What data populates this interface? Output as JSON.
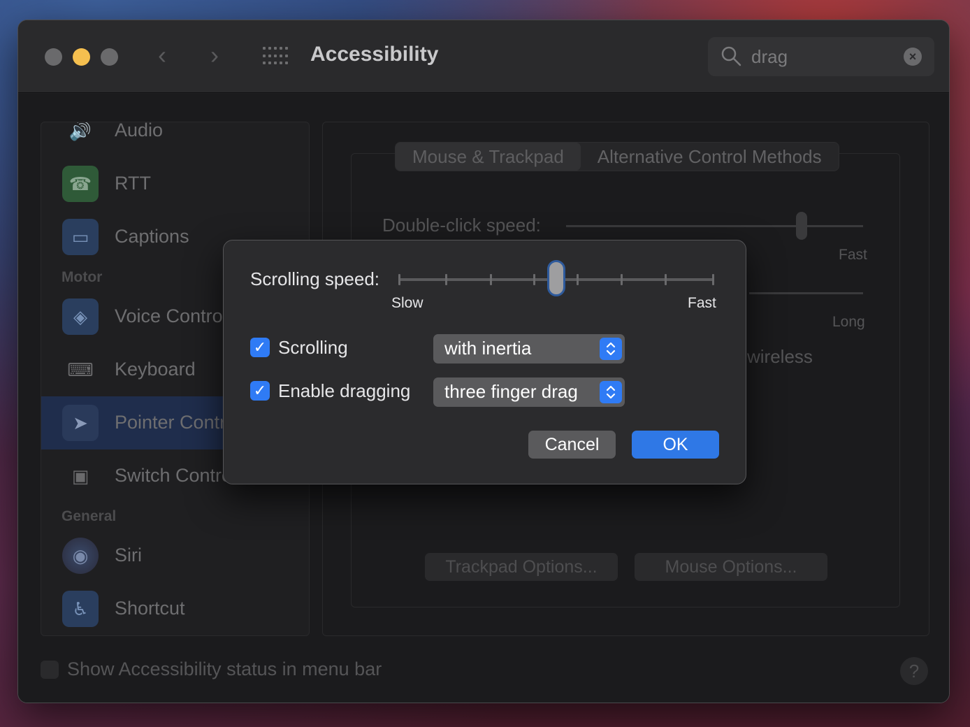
{
  "window": {
    "title": "Accessibility",
    "search": {
      "value": "drag"
    }
  },
  "sidebar": {
    "items": [
      {
        "label": "Audio",
        "icon": "speaker-icon"
      },
      {
        "label": "RTT",
        "icon": "phone-icon"
      },
      {
        "label": "Captions",
        "icon": "captions-icon"
      },
      {
        "label": "Voice Control",
        "icon": "voice-control-icon"
      },
      {
        "label": "Keyboard",
        "icon": "keyboard-icon"
      },
      {
        "label": "Pointer Control",
        "icon": "pointer-icon"
      },
      {
        "label": "Switch Control",
        "icon": "switch-control-icon"
      },
      {
        "label": "Siri",
        "icon": "siri-icon"
      },
      {
        "label": "Shortcut",
        "icon": "accessibility-shortcut-icon"
      }
    ],
    "sections": {
      "motor": "Motor",
      "general": "General"
    },
    "selected": "Pointer Control"
  },
  "main": {
    "tabs": [
      {
        "label": "Mouse & Trackpad",
        "active": true
      },
      {
        "label": "Alternative Control Methods",
        "active": false
      }
    ],
    "double_click_label": "Double-click speed:",
    "fast_label": "Fast",
    "long_label": "Long",
    "wireless_text": "wireless",
    "trackpad_options": "Trackpad Options...",
    "mouse_options": "Mouse Options..."
  },
  "footer": {
    "status_checkbox_label": "Show Accessibility status in menu bar",
    "help": "?"
  },
  "dialog": {
    "scrolling_speed_label": "Scrolling speed:",
    "slow_label": "Slow",
    "fast_label": "Fast",
    "scrolling_speed_level": 0.5,
    "scrolling": {
      "label": "Scrolling",
      "checked": true,
      "option": "with inertia"
    },
    "dragging": {
      "label": "Enable dragging",
      "checked": true,
      "option": "three finger drag"
    },
    "cancel": "Cancel",
    "ok": "OK"
  },
  "colors": {
    "accent": "#2f7bf5",
    "ok_button": "#2f78e6",
    "minimize": "#f5bf4f"
  }
}
